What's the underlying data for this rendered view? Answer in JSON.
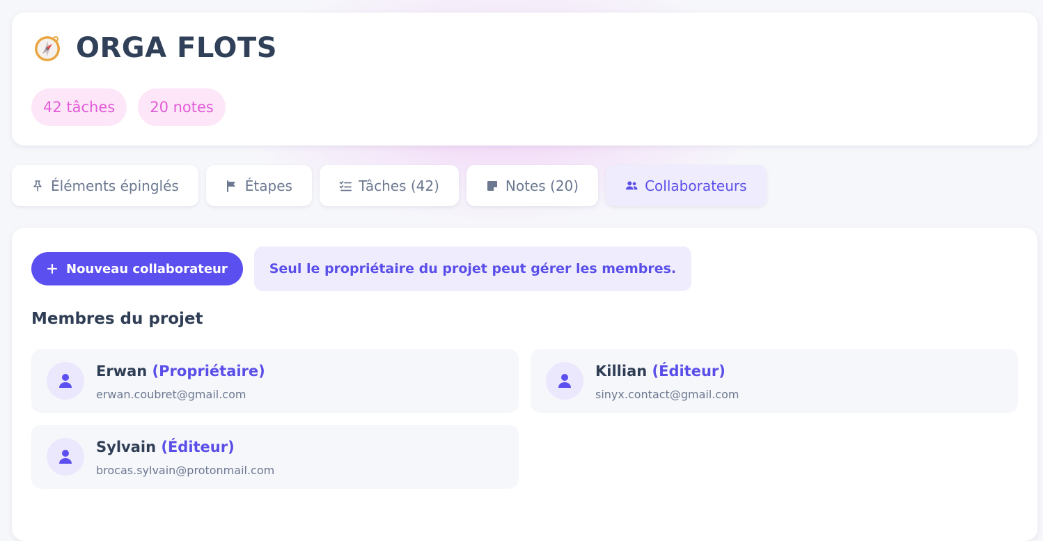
{
  "project": {
    "title": "ORGA FLOTS",
    "icon": "compass-icon",
    "badges": [
      {
        "label": "42 tâches"
      },
      {
        "label": "20 notes"
      }
    ]
  },
  "tabs": [
    {
      "label": "Éléments épinglés",
      "icon": "pin-icon"
    },
    {
      "label": "Étapes",
      "icon": "flag-icon"
    },
    {
      "label": "Tâches (42)",
      "icon": "checklist-icon"
    },
    {
      "label": "Notes (20)",
      "icon": "note-icon"
    },
    {
      "label": "Collaborateurs",
      "icon": "users-icon",
      "active": true
    }
  ],
  "collaborators": {
    "add_button_label": "Nouveau collaborateur",
    "info": "Seul le propriétaire du projet peut gérer les membres.",
    "section_title": "Membres du projet",
    "members": [
      {
        "name": "Erwan",
        "role": "(Propriétaire)",
        "email": "erwan.coubret@gmail.com"
      },
      {
        "name": "Killian",
        "role": "(Éditeur)",
        "email": "sinyx.contact@gmail.com"
      },
      {
        "name": "Sylvain",
        "role": "(Éditeur)",
        "email": "brocas.sylvain@protonmail.com"
      }
    ]
  },
  "colors": {
    "accent": "#5b4ff0",
    "badge_text": "#e25bd8",
    "badge_bg": "#fde6f8"
  }
}
